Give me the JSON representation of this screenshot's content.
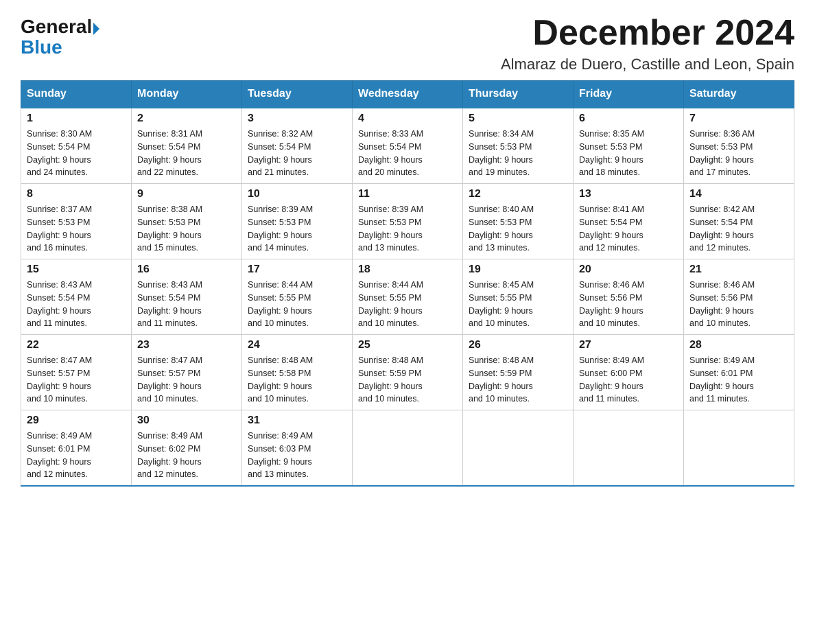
{
  "header": {
    "logo_general": "General",
    "logo_blue": "Blue",
    "month_year": "December 2024",
    "location": "Almaraz de Duero, Castille and Leon, Spain"
  },
  "weekdays": [
    "Sunday",
    "Monday",
    "Tuesday",
    "Wednesday",
    "Thursday",
    "Friday",
    "Saturday"
  ],
  "weeks": [
    [
      {
        "day": "1",
        "sunrise": "8:30 AM",
        "sunset": "5:54 PM",
        "daylight": "9 hours and 24 minutes."
      },
      {
        "day": "2",
        "sunrise": "8:31 AM",
        "sunset": "5:54 PM",
        "daylight": "9 hours and 22 minutes."
      },
      {
        "day": "3",
        "sunrise": "8:32 AM",
        "sunset": "5:54 PM",
        "daylight": "9 hours and 21 minutes."
      },
      {
        "day": "4",
        "sunrise": "8:33 AM",
        "sunset": "5:54 PM",
        "daylight": "9 hours and 20 minutes."
      },
      {
        "day": "5",
        "sunrise": "8:34 AM",
        "sunset": "5:53 PM",
        "daylight": "9 hours and 19 minutes."
      },
      {
        "day": "6",
        "sunrise": "8:35 AM",
        "sunset": "5:53 PM",
        "daylight": "9 hours and 18 minutes."
      },
      {
        "day": "7",
        "sunrise": "8:36 AM",
        "sunset": "5:53 PM",
        "daylight": "9 hours and 17 minutes."
      }
    ],
    [
      {
        "day": "8",
        "sunrise": "8:37 AM",
        "sunset": "5:53 PM",
        "daylight": "9 hours and 16 minutes."
      },
      {
        "day": "9",
        "sunrise": "8:38 AM",
        "sunset": "5:53 PM",
        "daylight": "9 hours and 15 minutes."
      },
      {
        "day": "10",
        "sunrise": "8:39 AM",
        "sunset": "5:53 PM",
        "daylight": "9 hours and 14 minutes."
      },
      {
        "day": "11",
        "sunrise": "8:39 AM",
        "sunset": "5:53 PM",
        "daylight": "9 hours and 13 minutes."
      },
      {
        "day": "12",
        "sunrise": "8:40 AM",
        "sunset": "5:53 PM",
        "daylight": "9 hours and 13 minutes."
      },
      {
        "day": "13",
        "sunrise": "8:41 AM",
        "sunset": "5:54 PM",
        "daylight": "9 hours and 12 minutes."
      },
      {
        "day": "14",
        "sunrise": "8:42 AM",
        "sunset": "5:54 PM",
        "daylight": "9 hours and 12 minutes."
      }
    ],
    [
      {
        "day": "15",
        "sunrise": "8:43 AM",
        "sunset": "5:54 PM",
        "daylight": "9 hours and 11 minutes."
      },
      {
        "day": "16",
        "sunrise": "8:43 AM",
        "sunset": "5:54 PM",
        "daylight": "9 hours and 11 minutes."
      },
      {
        "day": "17",
        "sunrise": "8:44 AM",
        "sunset": "5:55 PM",
        "daylight": "9 hours and 10 minutes."
      },
      {
        "day": "18",
        "sunrise": "8:44 AM",
        "sunset": "5:55 PM",
        "daylight": "9 hours and 10 minutes."
      },
      {
        "day": "19",
        "sunrise": "8:45 AM",
        "sunset": "5:55 PM",
        "daylight": "9 hours and 10 minutes."
      },
      {
        "day": "20",
        "sunrise": "8:46 AM",
        "sunset": "5:56 PM",
        "daylight": "9 hours and 10 minutes."
      },
      {
        "day": "21",
        "sunrise": "8:46 AM",
        "sunset": "5:56 PM",
        "daylight": "9 hours and 10 minutes."
      }
    ],
    [
      {
        "day": "22",
        "sunrise": "8:47 AM",
        "sunset": "5:57 PM",
        "daylight": "9 hours and 10 minutes."
      },
      {
        "day": "23",
        "sunrise": "8:47 AM",
        "sunset": "5:57 PM",
        "daylight": "9 hours and 10 minutes."
      },
      {
        "day": "24",
        "sunrise": "8:48 AM",
        "sunset": "5:58 PM",
        "daylight": "9 hours and 10 minutes."
      },
      {
        "day": "25",
        "sunrise": "8:48 AM",
        "sunset": "5:59 PM",
        "daylight": "9 hours and 10 minutes."
      },
      {
        "day": "26",
        "sunrise": "8:48 AM",
        "sunset": "5:59 PM",
        "daylight": "9 hours and 10 minutes."
      },
      {
        "day": "27",
        "sunrise": "8:49 AM",
        "sunset": "6:00 PM",
        "daylight": "9 hours and 11 minutes."
      },
      {
        "day": "28",
        "sunrise": "8:49 AM",
        "sunset": "6:01 PM",
        "daylight": "9 hours and 11 minutes."
      }
    ],
    [
      {
        "day": "29",
        "sunrise": "8:49 AM",
        "sunset": "6:01 PM",
        "daylight": "9 hours and 12 minutes."
      },
      {
        "day": "30",
        "sunrise": "8:49 AM",
        "sunset": "6:02 PM",
        "daylight": "9 hours and 12 minutes."
      },
      {
        "day": "31",
        "sunrise": "8:49 AM",
        "sunset": "6:03 PM",
        "daylight": "9 hours and 13 minutes."
      },
      null,
      null,
      null,
      null
    ]
  ],
  "labels": {
    "sunrise": "Sunrise:",
    "sunset": "Sunset:",
    "daylight": "Daylight:"
  }
}
